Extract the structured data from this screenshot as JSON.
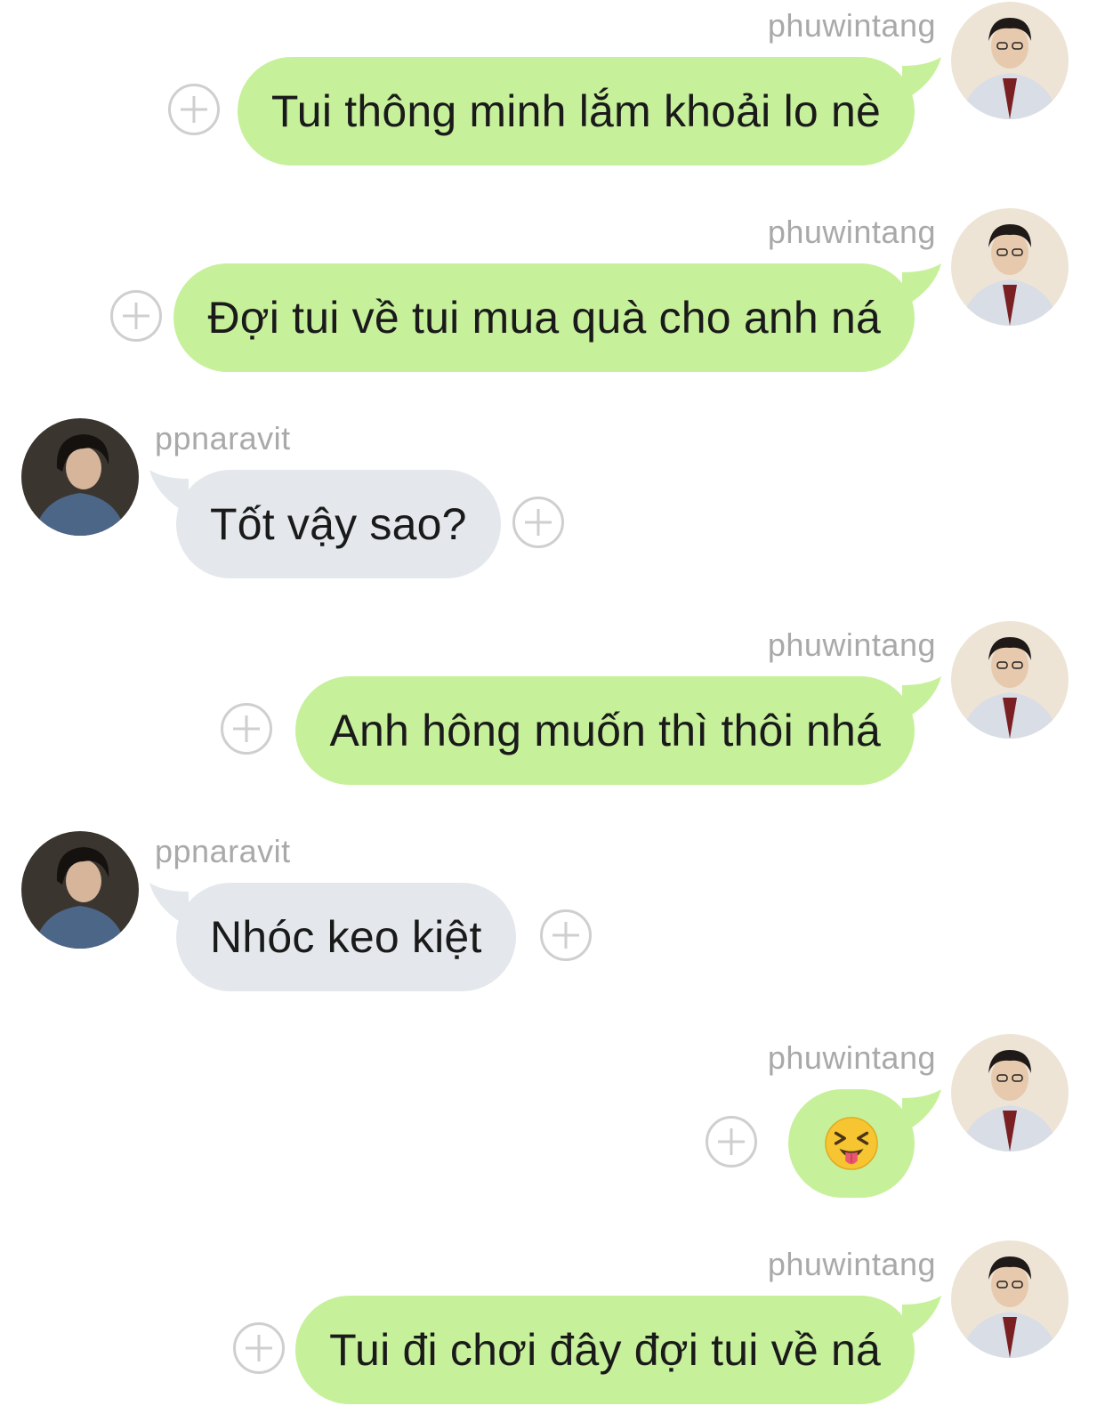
{
  "messages": [
    {
      "sender": "phuwintang",
      "side": "right",
      "text": "Tui thông minh lắm khoải lo nè"
    },
    {
      "sender": "phuwintang",
      "side": "right",
      "text": "Đợi tui về tui mua quà cho anh ná"
    },
    {
      "sender": "ppnaravit",
      "side": "left",
      "text": "Tốt vậy sao?"
    },
    {
      "sender": "phuwintang",
      "side": "right",
      "text": "Anh hông muốn thì thôi nhá"
    },
    {
      "sender": "ppnaravit",
      "side": "left",
      "text": "Nhóc keo kiệt"
    },
    {
      "sender": "phuwintang",
      "side": "right",
      "emoji": "squinting-face-with-tongue"
    },
    {
      "sender": "phuwintang",
      "side": "right",
      "text": "Tui đi chơi đây đợi tui về ná"
    }
  ],
  "colors": {
    "outgoing_bubble": "#c7f09b",
    "incoming_bubble": "#e4e8ec",
    "username": "#a9a9a9"
  }
}
